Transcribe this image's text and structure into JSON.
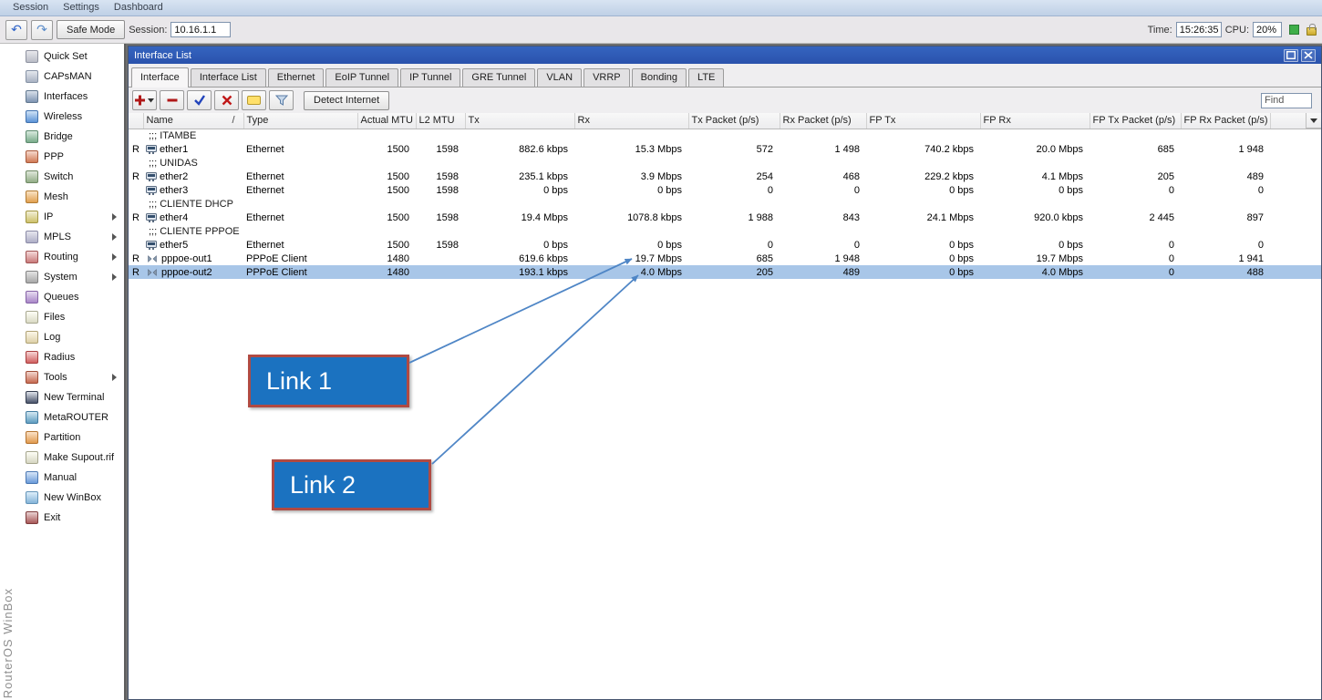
{
  "menubar": {
    "items": [
      "Session",
      "Settings",
      "Dashboard"
    ]
  },
  "topbar": {
    "safe_mode_label": "Safe Mode",
    "session_label": "Session:",
    "session_value": "10.16.1.1",
    "time_label": "Time:",
    "time_value": "15:26:35",
    "cpu_label": "CPU:",
    "cpu_value": "20%"
  },
  "brand_vertical": "RouterOS WinBox",
  "sidebar": {
    "items": [
      {
        "label": "Quick Set",
        "icon": "quick-set-icon"
      },
      {
        "label": "CAPsMAN",
        "icon": "capsman-icon"
      },
      {
        "label": "Interfaces",
        "icon": "interfaces-icon"
      },
      {
        "label": "Wireless",
        "icon": "wireless-icon"
      },
      {
        "label": "Bridge",
        "icon": "bridge-icon"
      },
      {
        "label": "PPP",
        "icon": "ppp-icon"
      },
      {
        "label": "Switch",
        "icon": "switch-icon"
      },
      {
        "label": "Mesh",
        "icon": "mesh-icon"
      },
      {
        "label": "IP",
        "icon": "ip-icon",
        "arrow": true
      },
      {
        "label": "MPLS",
        "icon": "mpls-icon",
        "arrow": true
      },
      {
        "label": "Routing",
        "icon": "routing-icon",
        "arrow": true
      },
      {
        "label": "System",
        "icon": "system-icon",
        "arrow": true
      },
      {
        "label": "Queues",
        "icon": "queues-icon"
      },
      {
        "label": "Files",
        "icon": "files-icon"
      },
      {
        "label": "Log",
        "icon": "log-icon"
      },
      {
        "label": "Radius",
        "icon": "radius-icon"
      },
      {
        "label": "Tools",
        "icon": "tools-icon",
        "arrow": true
      },
      {
        "label": "New Terminal",
        "icon": "terminal-icon"
      },
      {
        "label": "MetaROUTER",
        "icon": "metarouter-icon"
      },
      {
        "label": "Partition",
        "icon": "partition-icon"
      },
      {
        "label": "Make Supout.rif",
        "icon": "supout-icon"
      },
      {
        "label": "Manual",
        "icon": "manual-icon"
      },
      {
        "label": "New WinBox",
        "icon": "winbox-icon"
      },
      {
        "label": "Exit",
        "icon": "exit-icon"
      }
    ]
  },
  "window": {
    "title": "Interface List",
    "titlebar_buttons": [
      {
        "icon": "maximize-icon"
      },
      {
        "icon": "close-icon"
      }
    ],
    "tabs": [
      "Interface",
      "Interface List",
      "Ethernet",
      "EoIP Tunnel",
      "IP Tunnel",
      "GRE Tunnel",
      "VLAN",
      "VRRP",
      "Bonding",
      "LTE"
    ],
    "active_tab": "Interface",
    "toolbar": {
      "buttons": [
        {
          "icon": "add-icon"
        },
        {
          "icon": "remove-icon"
        },
        {
          "icon": "enable-icon"
        },
        {
          "icon": "disable-icon"
        },
        {
          "icon": "comment-icon"
        },
        {
          "icon": "filter-icon"
        }
      ],
      "detect_internet_label": "Detect Internet",
      "find_placeholder": "Find"
    },
    "table": {
      "sort_column": "Name",
      "sort_indicator": "/",
      "columns": [
        "Name",
        "Type",
        "Actual MTU",
        "L2 MTU",
        "Tx",
        "Rx",
        "Tx Packet (p/s)",
        "Rx Packet (p/s)",
        "FP Tx",
        "FP Rx",
        "FP Tx Packet (p/s)",
        "FP Rx Packet (p/s)"
      ],
      "rows": [
        {
          "comment": ";;; ITAMBE"
        },
        {
          "flag": "R",
          "name": "ether1",
          "icon": "ethernet-icon",
          "type": "Ethernet",
          "actual_mtu": "1500",
          "l2_mtu": "1598",
          "tx": "882.6 kbps",
          "rx": "15.3 Mbps",
          "tx_pps": "572",
          "rx_pps": "1 498",
          "fp_tx": "740.2 kbps",
          "fp_rx": "20.0 Mbps",
          "fp_tx_pps": "685",
          "fp_rx_pps": "1 948"
        },
        {
          "comment": ";;; UNIDAS"
        },
        {
          "flag": "R",
          "name": "ether2",
          "icon": "ethernet-icon",
          "type": "Ethernet",
          "actual_mtu": "1500",
          "l2_mtu": "1598",
          "tx": "235.1 kbps",
          "rx": "3.9 Mbps",
          "tx_pps": "254",
          "rx_pps": "468",
          "fp_tx": "229.2 kbps",
          "fp_rx": "4.1 Mbps",
          "fp_tx_pps": "205",
          "fp_rx_pps": "489"
        },
        {
          "flag": "",
          "name": "ether3",
          "icon": "ethernet-icon",
          "type": "Ethernet",
          "actual_mtu": "1500",
          "l2_mtu": "1598",
          "tx": "0 bps",
          "rx": "0 bps",
          "tx_pps": "0",
          "rx_pps": "0",
          "fp_tx": "0 bps",
          "fp_rx": "0 bps",
          "fp_tx_pps": "0",
          "fp_rx_pps": "0"
        },
        {
          "comment": ";;; CLIENTE DHCP"
        },
        {
          "flag": "R",
          "name": "ether4",
          "icon": "ethernet-icon",
          "type": "Ethernet",
          "actual_mtu": "1500",
          "l2_mtu": "1598",
          "tx": "19.4 Mbps",
          "rx": "1078.8 kbps",
          "tx_pps": "1 988",
          "rx_pps": "843",
          "fp_tx": "24.1 Mbps",
          "fp_rx": "920.0 kbps",
          "fp_tx_pps": "2 445",
          "fp_rx_pps": "897"
        },
        {
          "comment": ";;; CLIENTE PPPOE"
        },
        {
          "flag": "",
          "name": "ether5",
          "icon": "ethernet-icon",
          "type": "Ethernet",
          "actual_mtu": "1500",
          "l2_mtu": "1598",
          "tx": "0 bps",
          "rx": "0 bps",
          "tx_pps": "0",
          "rx_pps": "0",
          "fp_tx": "0 bps",
          "fp_rx": "0 bps",
          "fp_tx_pps": "0",
          "fp_rx_pps": "0"
        },
        {
          "flag": "R",
          "name": "pppoe-out1",
          "icon": "pppoe-icon",
          "type": "PPPoE Client",
          "actual_mtu": "1480",
          "l2_mtu": "",
          "tx": "619.6 kbps",
          "rx": "19.7 Mbps",
          "tx_pps": "685",
          "rx_pps": "1 948",
          "fp_tx": "0 bps",
          "fp_rx": "19.7 Mbps",
          "fp_tx_pps": "0",
          "fp_rx_pps": "1 941"
        },
        {
          "flag": "R",
          "name": "pppoe-out2",
          "icon": "pppoe-icon",
          "type": "PPPoE Client",
          "actual_mtu": "1480",
          "l2_mtu": "",
          "tx": "193.1 kbps",
          "rx": "4.0 Mbps",
          "tx_pps": "205",
          "rx_pps": "489",
          "fp_tx": "0 bps",
          "fp_rx": "4.0 Mbps",
          "fp_tx_pps": "0",
          "fp_rx_pps": "488",
          "selected": true
        }
      ]
    }
  },
  "annotations": {
    "boxes": [
      {
        "label": "Link 1"
      },
      {
        "label": "Link 2"
      }
    ]
  },
  "colors": {
    "annotation_fill": "#1b72c0",
    "annotation_border": "#b04a42",
    "arrow": "#4f86c6",
    "selection": "#a8c6e8",
    "status_ok": "#3fae49",
    "titlebar": "#3565c0"
  }
}
